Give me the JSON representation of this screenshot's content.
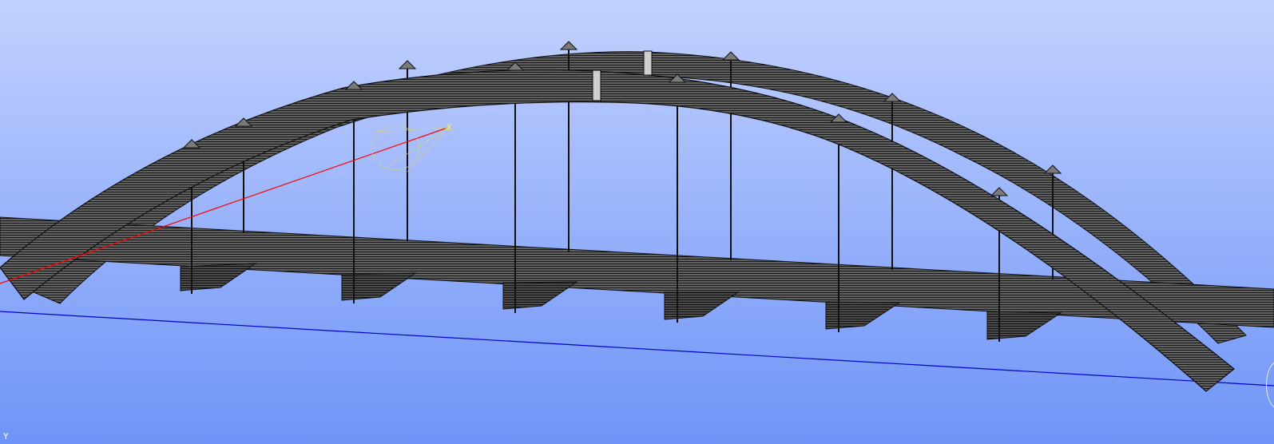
{
  "viewport": {
    "background_top": "#c3d1ff",
    "background_bottom": "#6e94f7"
  },
  "axes": {
    "x_label": "X",
    "y_label": "Y",
    "x_color": "#ffff00",
    "y_color": "#ffffff",
    "x_axis_line_color": "#ff0000",
    "z_axis_line_color": "#0000cc"
  },
  "model": {
    "member_color": "#5e5e5e",
    "stripe_color": "#1a1a1a",
    "hanger_count": 12,
    "crossbeam_count": 6
  }
}
